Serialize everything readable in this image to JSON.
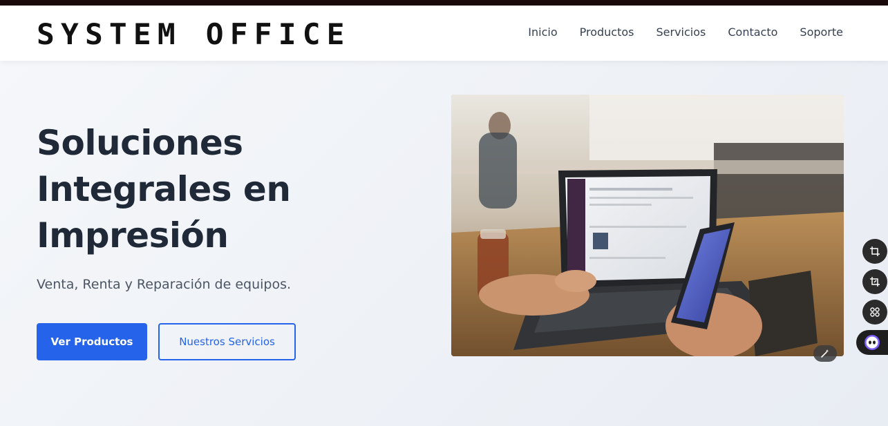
{
  "brand": {
    "logo_text": "SYSTEM OFFICE"
  },
  "nav": {
    "items": [
      {
        "label": "Inicio"
      },
      {
        "label": "Productos"
      },
      {
        "label": "Servicios"
      },
      {
        "label": "Contacto"
      },
      {
        "label": "Soporte"
      }
    ]
  },
  "hero": {
    "title": "Soluciones Integrales en Impresión",
    "subtitle": "Venta, Renta y Reparación de equipos.",
    "primary_button": "Ver Productos",
    "secondary_button": "Nuestros Servicios",
    "image_icon": "magic-wand-icon"
  },
  "side_tools": {
    "icons": [
      "crop-icon",
      "crop-alt-icon",
      "grid-icon",
      "assistant-icon"
    ]
  },
  "colors": {
    "accent": "#2563eb",
    "title": "#1f2937",
    "topbar": "#1a0a0c"
  }
}
